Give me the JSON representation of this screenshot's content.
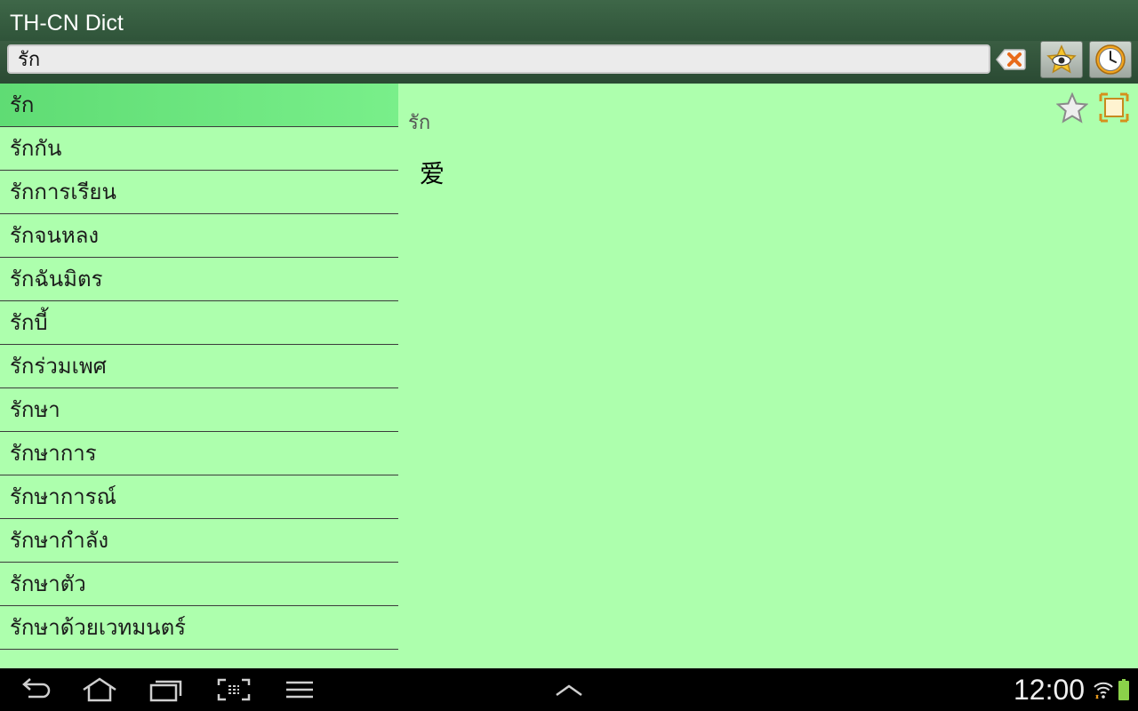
{
  "app": {
    "title": "TH-CN Dict"
  },
  "search": {
    "value": "รัก",
    "placeholder": ""
  },
  "word_list": [
    "รัก",
    "รักกัน",
    "รักการเรียน",
    "รักจนหลง",
    "รักฉันมิตร",
    "รักบี้",
    "รักร่วมเพศ",
    "รักษา",
    "รักษาการ",
    "รักษาการณ์",
    "รักษากำลัง",
    "รักษาตัว",
    "รักษาด้วยเวทมนตร์"
  ],
  "detail": {
    "headword": "รัก",
    "translation": "爱"
  },
  "status": {
    "time": "12:00"
  },
  "colors": {
    "list_bg": "#adffad",
    "selected_bg": "#6ce880",
    "titlebar_bg": "#3a5f43"
  },
  "icons": {
    "clear": "backspace-clear-icon",
    "eye": "eye-icon",
    "history": "clock-icon",
    "favorite": "star-icon",
    "expand": "fullscreen-icon"
  }
}
